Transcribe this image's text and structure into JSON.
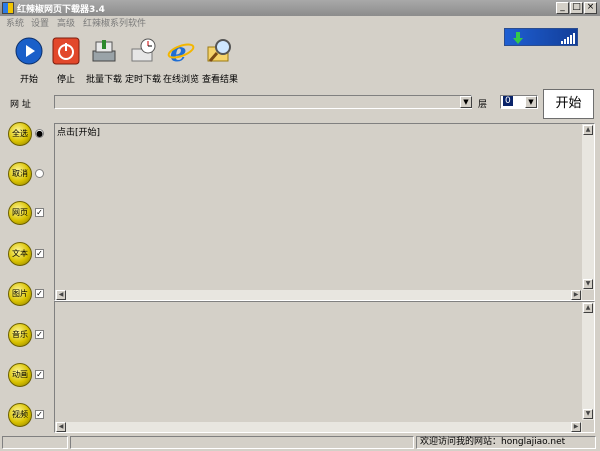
{
  "window": {
    "title": "红辣椒网页下载器3.4",
    "min": "_",
    "max": "□",
    "close": "×"
  },
  "menu": [
    "系统",
    "设置",
    "高级",
    "红辣椒系列软件"
  ],
  "toolbar": [
    {
      "label": "开始",
      "icon": "play-icon"
    },
    {
      "label": "停止",
      "icon": "power-icon"
    },
    {
      "label": "批量下载",
      "icon": "batch-download-icon"
    },
    {
      "label": "定时下载",
      "icon": "scheduled-download-icon"
    },
    {
      "label": "在线浏览",
      "icon": "ie-browser-icon"
    },
    {
      "label": "查看结果",
      "icon": "magnifier-folder-icon"
    }
  ],
  "address": {
    "label": "网 址",
    "value": ""
  },
  "layer": {
    "label": "层",
    "value": "0"
  },
  "start_button": "开始",
  "top_pane_text": "点击[开始]",
  "sidebar": [
    {
      "label": "全选",
      "control": "radio",
      "checked": true
    },
    {
      "label": "取消",
      "control": "radio",
      "checked": false
    },
    {
      "label": "网页",
      "control": "checkbox",
      "checked": true
    },
    {
      "label": "文本",
      "control": "checkbox",
      "checked": true
    },
    {
      "label": "图片",
      "control": "checkbox",
      "checked": true
    },
    {
      "label": "音乐",
      "control": "checkbox",
      "checked": true
    },
    {
      "label": "动画",
      "control": "checkbox",
      "checked": true
    },
    {
      "label": "视频",
      "control": "checkbox",
      "checked": true
    }
  ],
  "status": {
    "cell1": "",
    "cell2": "",
    "site_text": "欢迎访问我的网站：honglajiao.net"
  }
}
